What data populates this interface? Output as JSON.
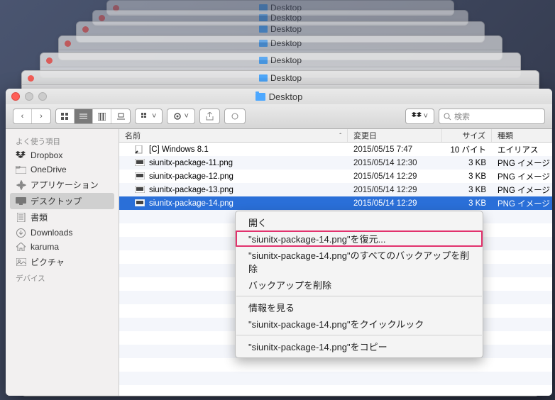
{
  "window": {
    "title": "Desktop"
  },
  "toolbar": {
    "search_placeholder": "検索"
  },
  "sidebar": {
    "fav_header": "よく使う項目",
    "dev_header": "デバイス",
    "items": [
      {
        "label": "Dropbox"
      },
      {
        "label": "OneDrive"
      },
      {
        "label": "アプリケーション"
      },
      {
        "label": "デスクトップ"
      },
      {
        "label": "書類"
      },
      {
        "label": "Downloads"
      },
      {
        "label": "karuma"
      },
      {
        "label": "ピクチャ"
      }
    ]
  },
  "columns": {
    "name": "名前",
    "date": "変更日",
    "size": "サイズ",
    "kind": "種類"
  },
  "files": [
    {
      "name": "[C] Windows 8.1",
      "date": "2015/05/15 7:47",
      "size": "10 バイト",
      "kind": "エイリアス"
    },
    {
      "name": "siunitx-package-11.png",
      "date": "2015/05/14 12:30",
      "size": "3 KB",
      "kind": "PNG イメージ"
    },
    {
      "name": "siunitx-package-12.png",
      "date": "2015/05/14 12:29",
      "size": "3 KB",
      "kind": "PNG イメージ"
    },
    {
      "name": "siunitx-package-13.png",
      "date": "2015/05/14 12:29",
      "size": "3 KB",
      "kind": "PNG イメージ"
    },
    {
      "name": "siunitx-package-14.png",
      "date": "2015/05/14 12:29",
      "size": "3 KB",
      "kind": "PNG イメージ"
    }
  ],
  "context_menu": {
    "open": "開く",
    "restore": "\"siunitx-package-14.png\"を復元...",
    "delete_all": "\"siunitx-package-14.png\"のすべてのバックアップを削除",
    "delete_backup": "バックアップを削除",
    "get_info": "情報を見る",
    "quicklook": "\"siunitx-package-14.png\"をクイックルック",
    "copy": "\"siunitx-package-14.png\"をコピー"
  }
}
